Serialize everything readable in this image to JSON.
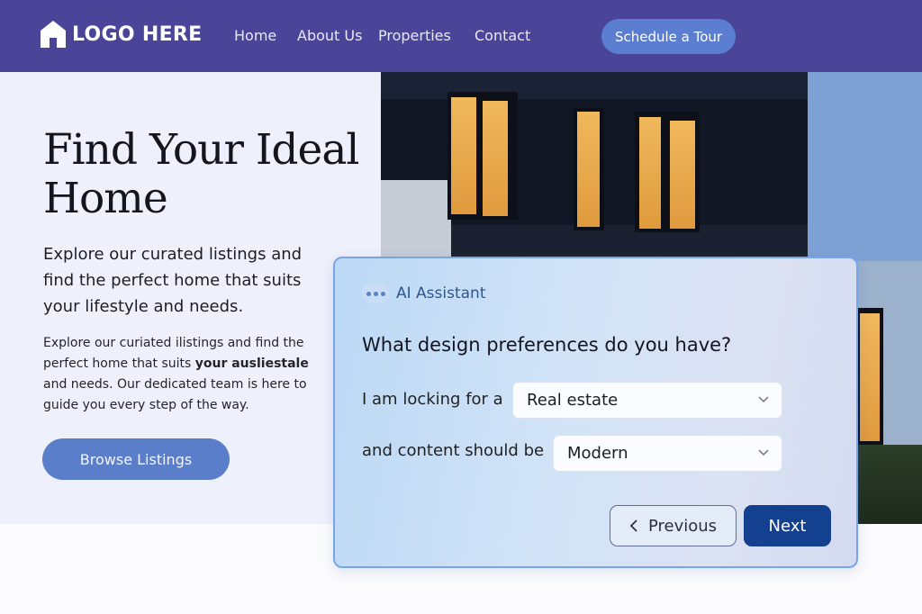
{
  "header": {
    "logo_text": "LOGO HERE",
    "logo_icon": "home-icon",
    "nav": [
      "Home",
      "About Us",
      "Properties",
      "Contact"
    ],
    "cta_label": "Schedule a Tour"
  },
  "hero": {
    "title": "Find Your Ideal Home",
    "subtitle": "Explore our curated listings and find the perfect home that suits your lifestyle and needs.",
    "body_part1": "Explore our curiated ilistings and find the perfect home that suits ",
    "body_bold": "your ausliestale",
    "body_part2": " and needs. Our dedicated team is here to guide you every step of the way.",
    "button_label": "Browse Listings"
  },
  "assistant": {
    "icon": "typing-dots-icon",
    "label": "AI Assistant",
    "question": "What design preferences do you have?",
    "row1_label": "I am locking for a",
    "row1_value": "Real estate",
    "row2_label": "and content should be",
    "row2_value": "Modern",
    "prev_label": "Previous",
    "next_label": "Next"
  },
  "colors": {
    "nav_bg": "#4a4598",
    "accent": "#5b7ecb",
    "next_button": "#14418f",
    "hero_bg": "#eef0fb"
  }
}
